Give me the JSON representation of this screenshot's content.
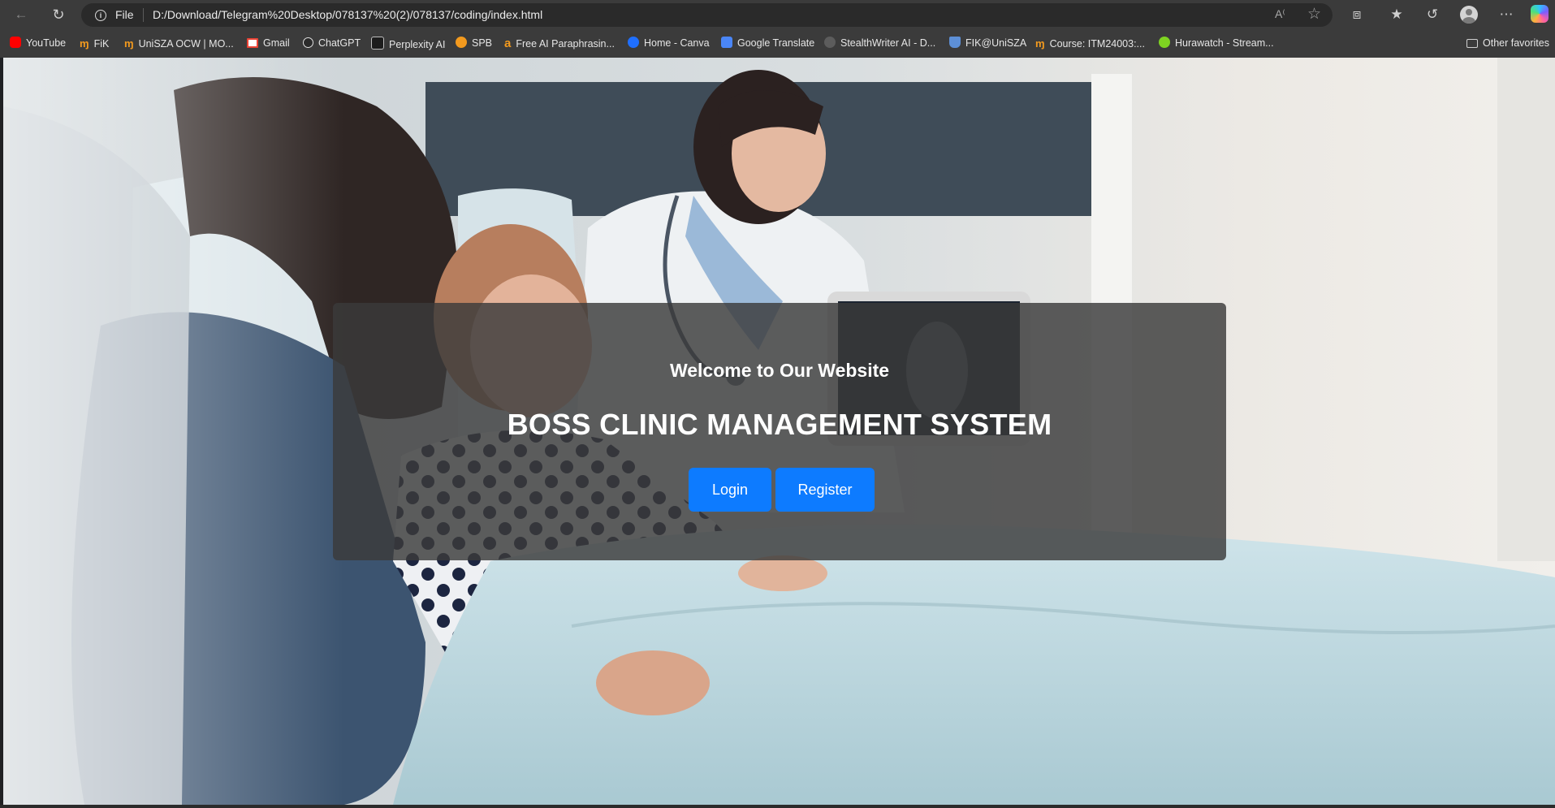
{
  "browser": {
    "address_bar": {
      "scheme_label": "File",
      "url": "D:/Download/Telegram%20Desktop/078137%20(2)/078137/coding/index.html"
    },
    "bookmarks": [
      {
        "label": "YouTube",
        "icon": "youtube-icon"
      },
      {
        "label": "FiK",
        "icon": "unisza-icon"
      },
      {
        "label": "UniSZA OCW | MO...",
        "icon": "unisza-icon"
      },
      {
        "label": "Gmail",
        "icon": "gmail-icon"
      },
      {
        "label": "ChatGPT",
        "icon": "chatgpt-icon"
      },
      {
        "label": "Perplexity AI",
        "icon": "perplexity-icon"
      },
      {
        "label": "SPB",
        "icon": "spb-icon"
      },
      {
        "label": "Free AI Paraphrasin...",
        "icon": "paraphrase-icon"
      },
      {
        "label": "Home - Canva",
        "icon": "canva-icon"
      },
      {
        "label": "Google Translate",
        "icon": "translate-icon"
      },
      {
        "label": "StealthWriter AI - D...",
        "icon": "stealthwriter-icon"
      },
      {
        "label": "FIK@UniSZA",
        "icon": "fik-icon"
      },
      {
        "label": "Course: ITM24003:...",
        "icon": "unisza-icon"
      },
      {
        "label": "Hurawatch - Stream...",
        "icon": "hurawatch-icon"
      }
    ],
    "other_favorites": "Other favorites"
  },
  "page": {
    "welcome": "Welcome to Our Website",
    "title": "BOSS CLINIC MANAGEMENT SYSTEM",
    "login_label": "Login",
    "register_label": "Register"
  },
  "colors": {
    "button": "#0d7bff",
    "card": "rgba(58,58,58,0.82)",
    "chrome": "#3b3b3b"
  }
}
